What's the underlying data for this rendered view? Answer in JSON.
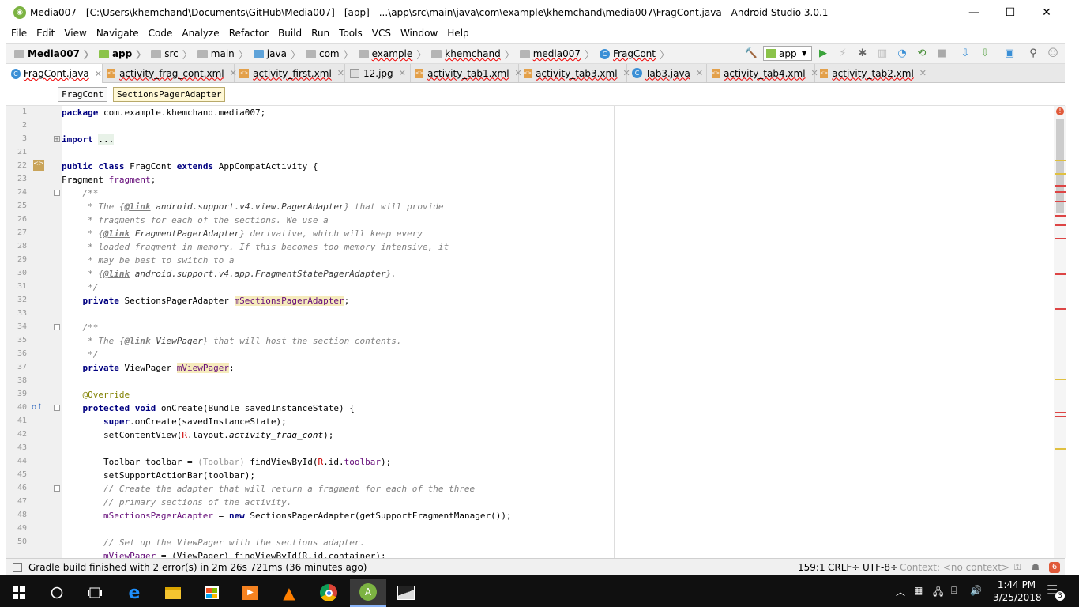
{
  "window": {
    "title": "Media007 - [C:\\Users\\khemchand\\Documents\\GitHub\\Media007] - [app] - ...\\app\\src\\main\\java\\com\\example\\khemchand\\media007\\FragCont.java - Android Studio 3.0.1",
    "minimize": "—",
    "maximize": "☐",
    "close": "✕"
  },
  "menu": [
    "File",
    "Edit",
    "View",
    "Navigate",
    "Code",
    "Analyze",
    "Refactor",
    "Build",
    "Run",
    "Tools",
    "VCS",
    "Window",
    "Help"
  ],
  "breadcrumb": [
    "Media007",
    "app",
    "src",
    "main",
    "java",
    "com",
    "example",
    "khemchand",
    "media007",
    "FragCont"
  ],
  "run_config": "app",
  "tabs": [
    {
      "label": "FragCont.java",
      "kind": "class"
    },
    {
      "label": "activity_frag_cont.xml",
      "kind": "xml"
    },
    {
      "label": "activity_first.xml",
      "kind": "xml"
    },
    {
      "label": "12.jpg",
      "kind": "image"
    },
    {
      "label": "activity_tab1.xml",
      "kind": "xml"
    },
    {
      "label": "activity_tab3.xml",
      "kind": "xml"
    },
    {
      "label": "Tab3.java",
      "kind": "class"
    },
    {
      "label": "activity_tab4.xml",
      "kind": "xml"
    },
    {
      "label": "activity_tab2.xml",
      "kind": "xml"
    }
  ],
  "structure_crumbs": [
    "FragCont",
    "SectionsPagerAdapter"
  ],
  "line_numbers": [
    "1",
    "2",
    "3",
    "21",
    "22",
    "23",
    "24",
    "25",
    "26",
    "27",
    "28",
    "29",
    "30",
    "31",
    "32",
    "33",
    "34",
    "35",
    "36",
    "37",
    "38",
    "39",
    "40",
    "41",
    "42",
    "43",
    "44",
    "45",
    "46",
    "47",
    "48",
    "49",
    "50"
  ],
  "code": {
    "l1_a": "package",
    "l1_b": " com.example.khemchand.media007;",
    "l3_a": "import",
    "l3_b": "...",
    "l22_a": "public class",
    "l22_b": " FragCont ",
    "l22_c": "extends",
    "l22_d": " AppCompatActivity {",
    "l23_a": "Fragment ",
    "l23_b": "fragment",
    "l23_c": ";",
    "l24": "    /**",
    "l25_a": "     * The {",
    "l25_b": "@link",
    "l25_c": " android.support.v4.view.PagerAdapter",
    "l25_d": "} that will provide",
    "l26": "     * fragments for each of the sections. We use a",
    "l27_a": "     * {",
    "l27_b": "@link",
    "l27_c": " FragmentPagerAdapter",
    "l27_d": "} derivative, which will keep every",
    "l28": "     * loaded fragment in memory. If this becomes too memory intensive, it",
    "l29": "     * may be best to switch to a",
    "l30_a": "     * {",
    "l30_b": "@link",
    "l30_c": " android.support.v4.app.FragmentStatePagerAdapter",
    "l30_d": "}.",
    "l31": "     */",
    "l32_a": "    private",
    "l32_b": " SectionsPagerAdapter ",
    "l32_c": "mSectionsPagerAdapter",
    "l32_d": ";",
    "l34": "    /**",
    "l35_a": "     * The {",
    "l35_b": "@link",
    "l35_c": " ViewPager",
    "l35_d": "} that will host the section contents.",
    "l36": "     */",
    "l37_a": "    private",
    "l37_b": " ViewPager ",
    "l37_c": "mViewPager",
    "l37_d": ";",
    "l39": "    @Override",
    "l40_a": "    protected void",
    "l40_b": " onCreate(Bundle savedInstanceState) {",
    "l41_a": "        super",
    "l41_b": ".onCreate(savedInstanceState);",
    "l42_a": "        setContentView(",
    "l42_b": "R",
    "l42_c": ".layout.",
    "l42_d": "activity_frag_cont",
    "l42_e": ");",
    "l44_a": "        Toolbar toolbar = ",
    "l44_b": "(Toolbar)",
    "l44_c": " findViewById(",
    "l44_d": "R",
    "l44_e": ".id.",
    "l44_f": "toolbar",
    "l44_g": ");",
    "l45": "        setSupportActionBar(toolbar);",
    "l46": "        // Create the adapter that will return a fragment for each of the three",
    "l47": "        // primary sections of the activity.",
    "l48_a": "        mSectionsPagerAdapter",
    "l48_b": " = ",
    "l48_c": "new",
    "l48_d": " SectionsPagerAdapter(getSupportFragmentManager());",
    "l50": "        // Set up the ViewPager with the sections adapter.",
    "l51_a": "        mViewPager",
    "l51_b": " = (ViewPager) findViewById(R.id.container);"
  },
  "status": {
    "message": "Gradle build finished with 2 error(s) in 2m 26s 721ms (36 minutes ago)",
    "position": "159:1",
    "line_sep": "CRLF÷",
    "encoding": "UTF-8÷",
    "context": "Context: <no context>",
    "error_count": "6"
  },
  "taskbar": {
    "time": "1:44 PM",
    "date": "3/25/2018",
    "notif_count": "3"
  },
  "colors": {
    "accent": "#3a8fd6",
    "error": "#e05a3a",
    "taskbar": "#101010"
  }
}
